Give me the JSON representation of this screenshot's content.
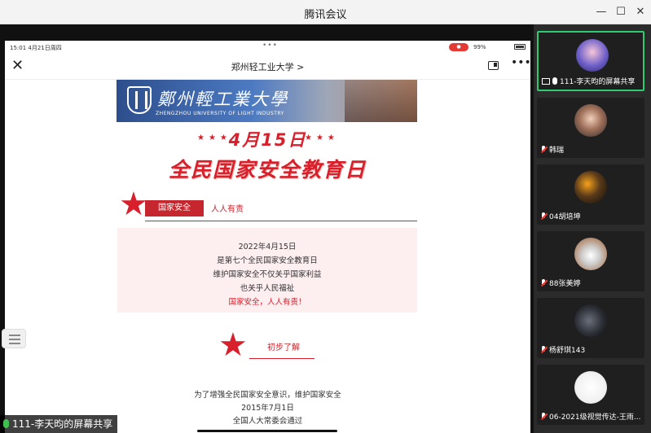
{
  "window": {
    "title": "腾讯会议",
    "controls": {
      "minimize": "—",
      "maximize": "☐",
      "close": "✕"
    }
  },
  "phone": {
    "status_time": "15:01  4月21日周四",
    "status_dots": "•••",
    "status_right": "99%",
    "nav_title": "郑州轻工业大学 >",
    "close_icon": "✕",
    "more_icon": "•••"
  },
  "banner": {
    "cn": "鄭州輕工業大學",
    "en": "ZHENGZHOU UNIVERSITY OF LIGHT INDUSTRY"
  },
  "article": {
    "date_headline": "4月15日",
    "main_headline": "全民国家安全教育日",
    "section1_tag": "国家安全",
    "section1_tag2": "人人有责",
    "pink_lines": [
      "2022年4月15日",
      "是第七个全民国家安全教育日",
      "维护国家安全不仅关乎国家利益",
      "也关乎人民福祉",
      "国家安全，人人有责！"
    ],
    "section2_label": "初步了解",
    "body_lines": [
      "为了增强全民国家安全意识，维护国家安全",
      "2015年7月1日",
      "全国人大常委会通过"
    ]
  },
  "share_label": "111-李天昀的屏幕共享",
  "participants": [
    {
      "name": "111-李天昀的屏幕共享",
      "mic": "on",
      "active": true
    },
    {
      "name": "韩瑞",
      "mic": "off",
      "active": false
    },
    {
      "name": "04胡培坤",
      "mic": "off",
      "active": false
    },
    {
      "name": "88张美婷",
      "mic": "off",
      "active": false
    },
    {
      "name": "杨舒琪143",
      "mic": "off",
      "active": false
    },
    {
      "name": "06-2021级视觉传达-王雨...",
      "mic": "off",
      "active": false
    }
  ],
  "colors": {
    "accent_red": "#d7202b",
    "active_border": "#2ecc71"
  }
}
